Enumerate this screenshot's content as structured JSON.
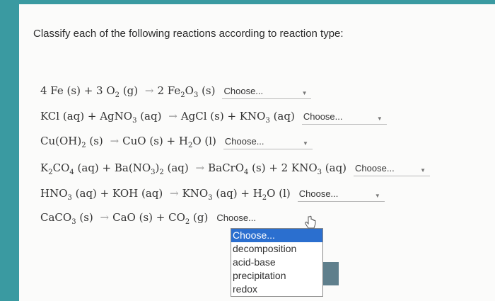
{
  "question": "Classify each of the following reactions according to reaction type:",
  "reactions": [
    {
      "pre": "4 Fe (s) + 3 O",
      "s1": "2",
      "post1": " (g) ",
      "arrow": "→",
      "rhs": "2 Fe",
      "s2": "2",
      "rhs2": "O",
      "s3": "3",
      "rhs3": " (s)",
      "select": "Choose..."
    },
    {
      "lhs": "KCl (aq) + AgNO",
      "s1": "3",
      "lhs2": " (aq) ",
      "arrow": "→",
      "rhs": "AgCl (s) + KNO",
      "s2": "3",
      "rhs2": " (aq)",
      "select": "Choose..."
    },
    {
      "lhs": "Cu(OH)",
      "s1": "2",
      "lhs2": " (s) ",
      "arrow": "→",
      "rhs": "CuO (s) + H",
      "s2": "2",
      "rhs2": "O (l)",
      "select": "Choose..."
    },
    {
      "lhs": "K",
      "s1": "2",
      "lhs2": "CO",
      "s2": "4",
      "lhs3": " (aq) + Ba(NO",
      "s3": "3",
      "lhs4": ")",
      "s4": "2",
      "lhs5": " (aq) ",
      "arrow": "→",
      "rhs": "BaCrO",
      "s5": "4",
      "rhs2": " (s) + 2 KNO",
      "s6": "3",
      "rhs3": " (aq)",
      "select": "Choose..."
    },
    {
      "lhs": "HNO",
      "s1": "3",
      "lhs2": " (aq) + KOH (aq) ",
      "arrow": "→",
      "rhs": "KNO",
      "s2": "3",
      "rhs2": " (aq) + H",
      "s3": "2",
      "rhs3": "O (l)",
      "select": "Choose..."
    },
    {
      "lhs": "CaCO",
      "s1": "3",
      "lhs2": " (s) ",
      "arrow": "→",
      "rhs": "CaO (s) + CO",
      "s2": "2",
      "rhs2": " (g)",
      "select": "Choose..."
    }
  ],
  "dropdown_options": [
    "Choose...",
    "decomposition",
    "acid-base",
    "precipitation",
    "redox"
  ],
  "colors": {
    "background": "#3a9aa1",
    "highlight": "#2b6fcf"
  }
}
